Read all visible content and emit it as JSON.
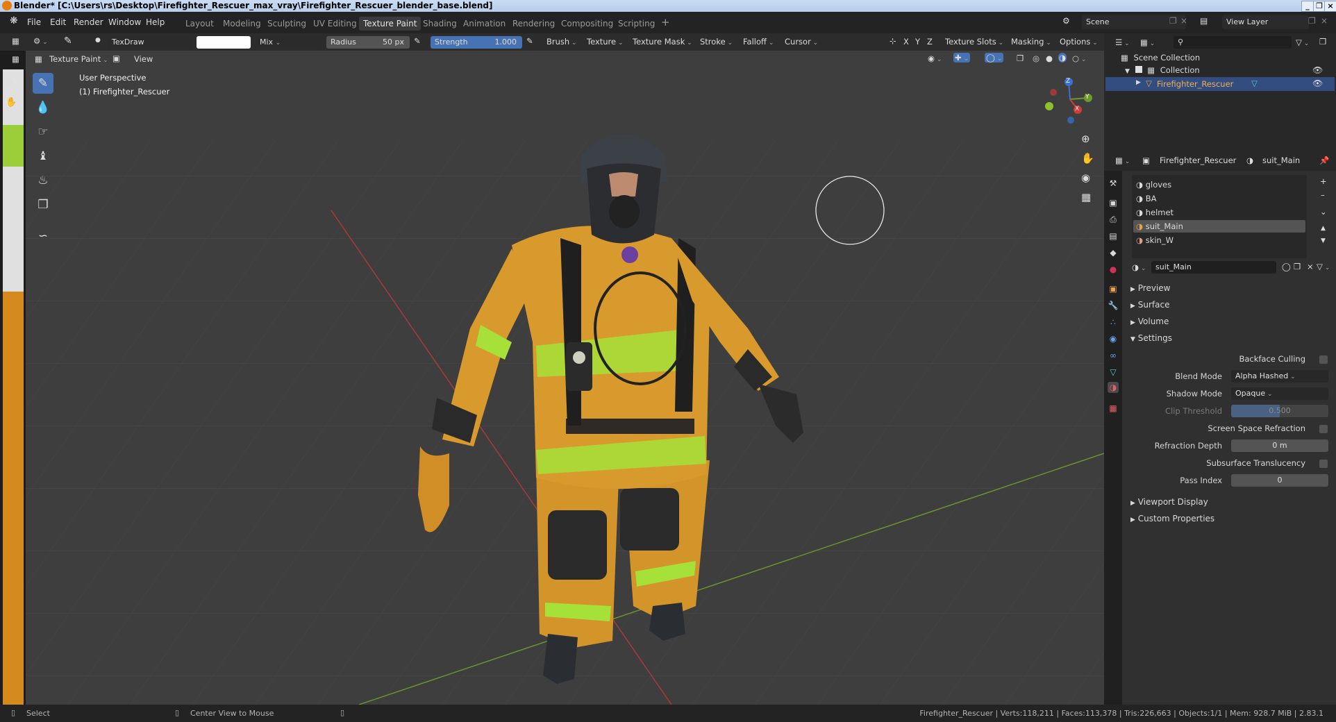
{
  "window": {
    "title": "Blender* [C:\\Users\\rs\\Desktop\\Firefighter_Rescuer_max_vray\\Firefighter_Rescuer_blender_base.blend]"
  },
  "menu": [
    "File",
    "Edit",
    "Render",
    "Window",
    "Help"
  ],
  "workspaces": [
    "Layout",
    "Modeling",
    "Sculpting",
    "UV Editing",
    "Texture Paint",
    "Shading",
    "Animation",
    "Rendering",
    "Compositing",
    "Scripting"
  ],
  "active_workspace": "Texture Paint",
  "scene": {
    "name": "Scene",
    "view_layer": "View Layer"
  },
  "tool_header": {
    "brush_name": "TexDraw",
    "blend": "Mix",
    "radius_label": "Radius",
    "radius_value": "50 px",
    "strength_label": "Strength",
    "strength_value": "1.000",
    "menus": [
      "Brush",
      "Texture",
      "Texture Mask",
      "Stroke",
      "Falloff",
      "Cursor"
    ],
    "axes": [
      "X",
      "Y",
      "Z"
    ],
    "right_menus": [
      "Texture Slots",
      "Masking",
      "Options"
    ]
  },
  "view_header": {
    "mode": "Texture Paint",
    "view": "View"
  },
  "viewport": {
    "overlay_line1": "User Perspective",
    "overlay_line2": "(1) Firefighter_Rescuer",
    "gizmo_axes": [
      "Z",
      "Y",
      "X"
    ]
  },
  "outliner": {
    "root": "Scene Collection",
    "collection": "Collection",
    "object": "Firefighter_Rescuer",
    "search_placeholder": ""
  },
  "properties": {
    "object_name": "Firefighter_Rescuer",
    "material_name": "suit_Main",
    "material_slots": [
      "gloves",
      "BA",
      "helmet",
      "suit_Main",
      "skin_W"
    ],
    "selected_slot": "suit_Main",
    "datablock": "suit_Main",
    "panels": {
      "preview": "Preview",
      "surface": "Surface",
      "volume": "Volume",
      "settings": "Settings",
      "viewport_display": "Viewport Display",
      "custom_properties": "Custom Properties"
    },
    "settings": {
      "backface_culling": "Backface Culling",
      "blend_mode_label": "Blend Mode",
      "blend_mode": "Alpha Hashed",
      "shadow_mode_label": "Shadow Mode",
      "shadow_mode": "Opaque",
      "clip_threshold_label": "Clip Threshold",
      "clip_threshold": "0.500",
      "screen_space_refraction": "Screen Space Refraction",
      "refraction_depth_label": "Refraction Depth",
      "refraction_depth": "0 m",
      "subsurface_translucency": "Subsurface Translucency",
      "pass_index_label": "Pass Index",
      "pass_index": "0"
    }
  },
  "statusbar": {
    "left_action": "Select",
    "middle_action": "Center View to Mouse",
    "stats": "Firefighter_Rescuer | Verts:118,211 | Faces:113,378 | Tris:226,663 | Objects:1/1 | Mem: 928.7 MiB | 2.83.1"
  },
  "colors": {
    "accent": "#4772b3",
    "suit": "#d89a2c",
    "reflective": "#a6e13a",
    "background": "#3e3e3e"
  }
}
